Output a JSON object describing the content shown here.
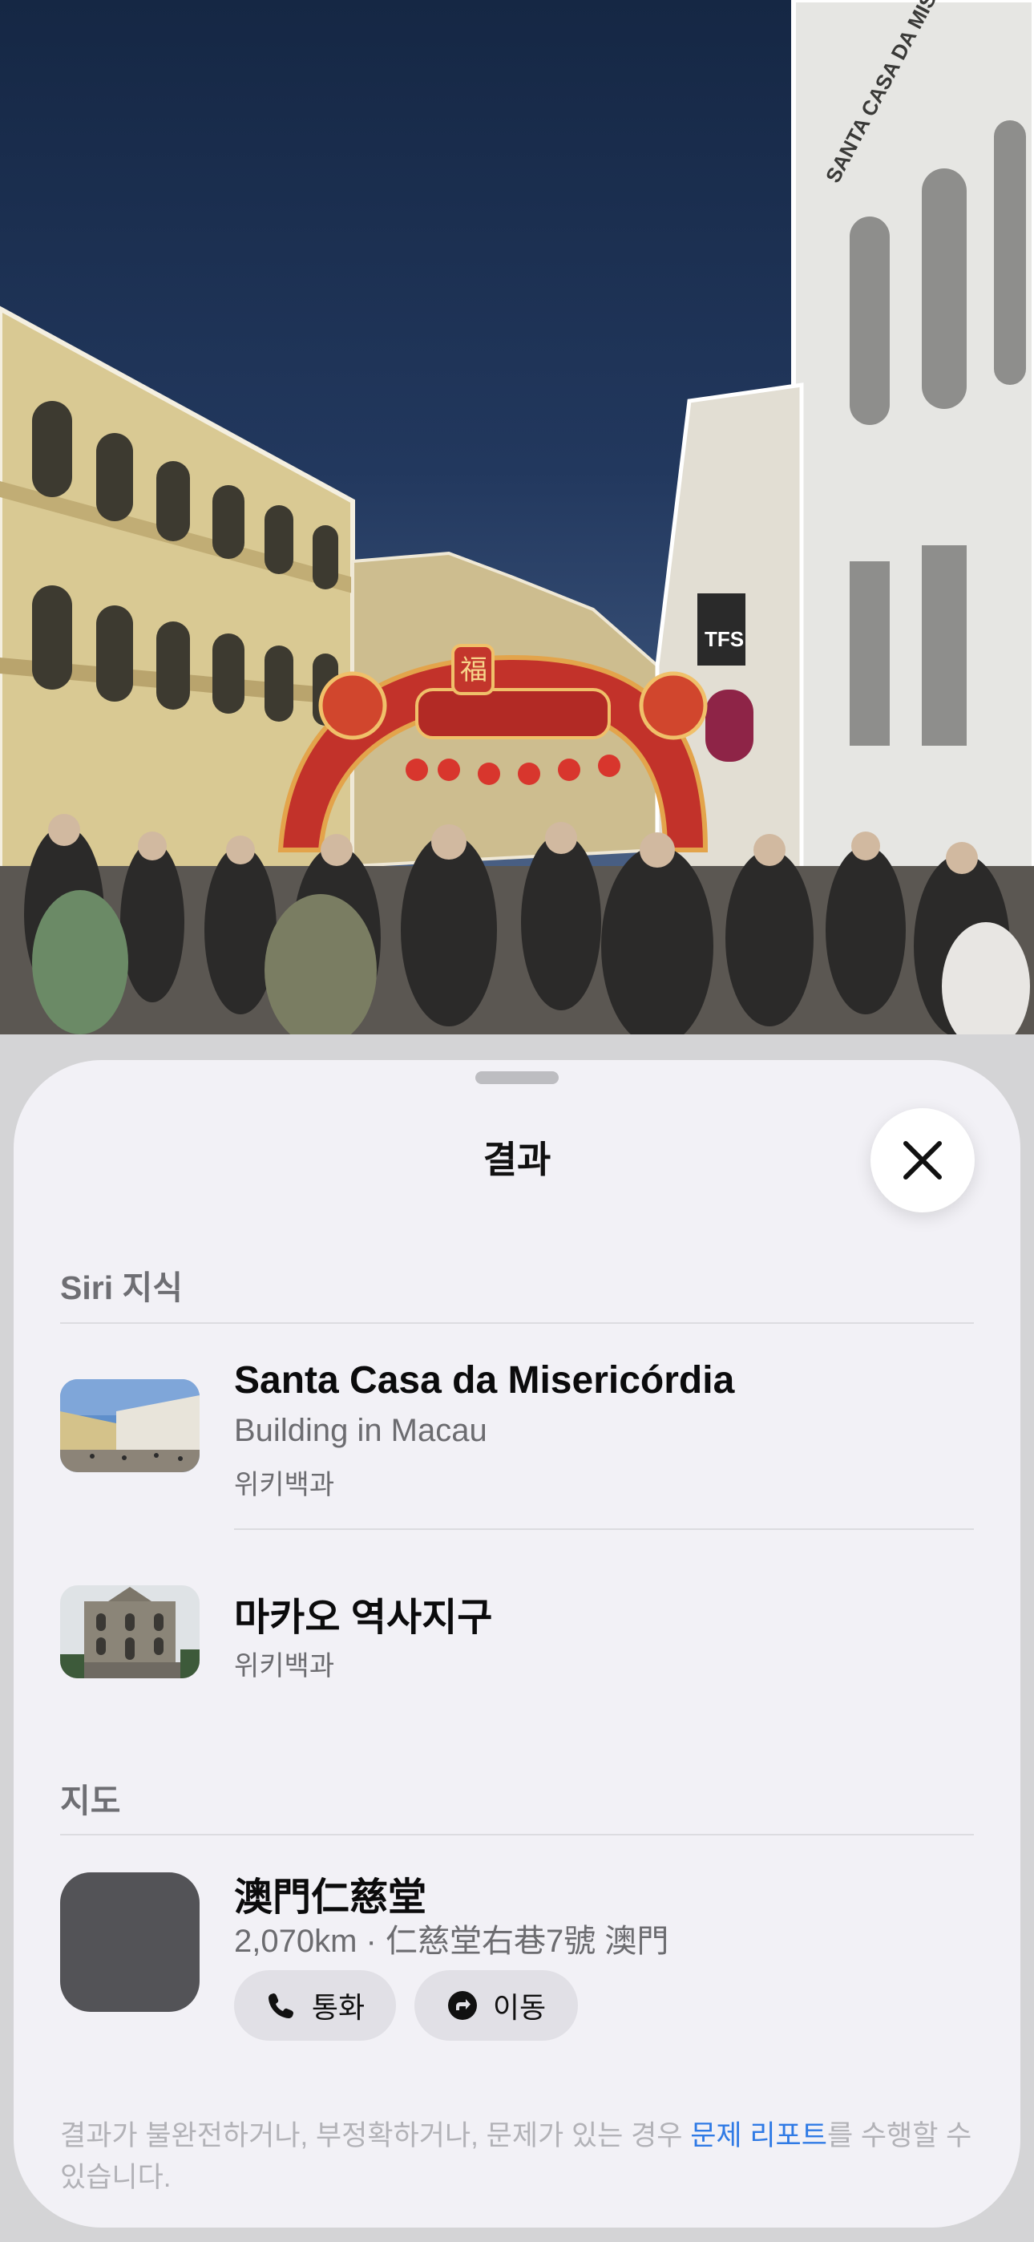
{
  "photo": {
    "signs": {
      "building_sign": "SANTA CASA DA MISERICÓRDIA",
      "shop_sign": "TFS",
      "arch_character": "福"
    }
  },
  "sheet": {
    "title": "결과",
    "close_icon": "close-x-icon"
  },
  "siri_knowledge": {
    "label": "Siri 지식",
    "results": [
      {
        "title": "Santa Casa da Misericórdia",
        "subtitle": "Building in Macau",
        "source": "위키백과"
      },
      {
        "title": "마카오 역사지구",
        "source": "위키백과"
      }
    ]
  },
  "maps": {
    "label": "지도",
    "place": {
      "name": "澳門仁慈堂",
      "detail": "2,070km · 仁慈堂右巷7號 澳門",
      "call_label": "통화",
      "call_icon": "phone-icon",
      "directions_label": "이동",
      "directions_icon": "directions-arrow-icon"
    }
  },
  "footer": {
    "text_before": "결과가 불완전하거나, 부정확하거나, 문제가 있는 경우 ",
    "link": "문제 리포트",
    "text_after": "를 수행할 수 있습니다."
  },
  "colors": {
    "sheet_bg": "#f2f1f6",
    "link": "#2f7ae5",
    "secondary_text": "#6c6c70"
  }
}
